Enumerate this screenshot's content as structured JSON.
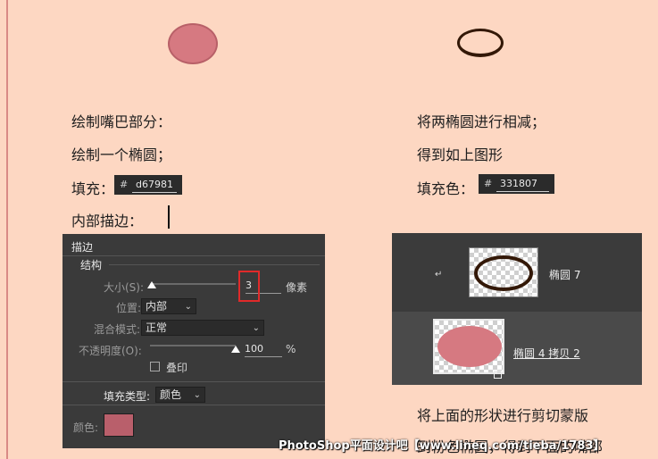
{
  "colors": {
    "background": "#fdd7c2",
    "pink_fill": "#d67981",
    "ring_fill": "#331807",
    "panel_bg": "#3a3a3a",
    "highlight_red": "#e02a2a",
    "stroke_color": "#b95f6b"
  },
  "left_column": {
    "line1": "绘制嘴巴部分：",
    "line2": "绘制一个椭圆；",
    "fill_label": "填充：",
    "fill_hex": "d67981",
    "stroke_label": "内部描边："
  },
  "right_column": {
    "line1": "将两椭圆进行相减；",
    "line2": "得到如上图形",
    "fill_label": "填充色：",
    "fill_hex": "331807",
    "line3": "将上面的形状进行剪切蒙版",
    "line4": "到粉色椭圆，得到下面的嘴部"
  },
  "stroke_panel": {
    "title": "描边",
    "section": "结构",
    "size_label": "大小(S):",
    "size_value": "3",
    "size_unit": "像素",
    "position_label": "位置:",
    "position_value": "内部",
    "blend_label": "混合模式:",
    "blend_value": "正常",
    "opacity_label": "不透明度(O):",
    "opacity_value": "100",
    "opacity_unit": "%",
    "overprint_label": "叠印",
    "fill_type_label": "填充类型:",
    "fill_type_value": "颜色",
    "color_label": "颜色:"
  },
  "layers_panel": {
    "layer1_name": "椭圆 7",
    "layer2_name": "椭圆 4 拷贝 2"
  },
  "hex_symbol": "#",
  "watermark": "PhotoShop平面设计吧【www.lineq.com/tieba/1783】"
}
